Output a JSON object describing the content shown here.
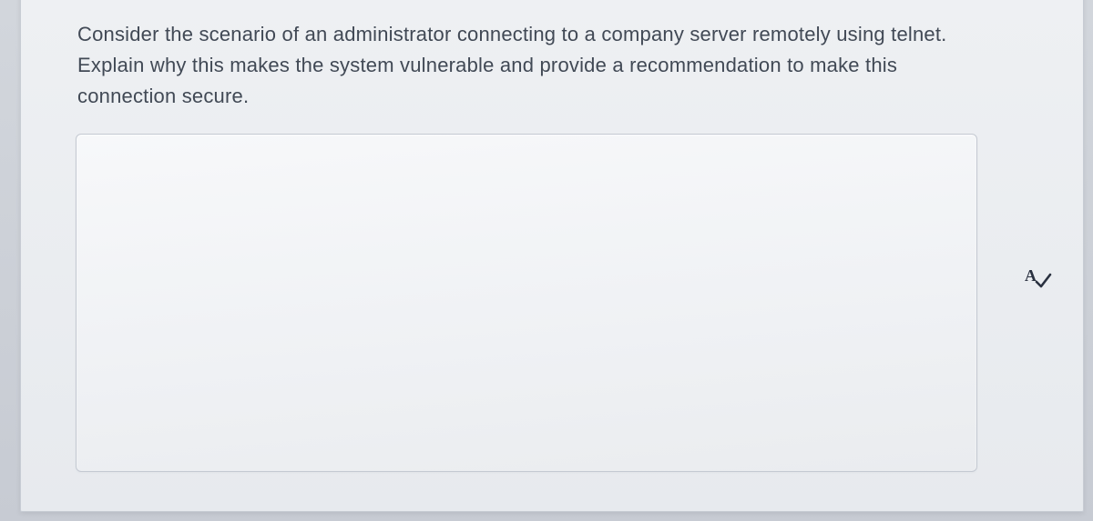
{
  "question": {
    "prompt": "Consider the scenario of an administrator connecting to a company  server remotely using telnet. Explain why this makes the system vulnerable and provide a recommendation to make this connection secure."
  },
  "answer": {
    "value": "",
    "placeholder": ""
  },
  "icons": {
    "spellcheck": "spellcheck-icon"
  }
}
